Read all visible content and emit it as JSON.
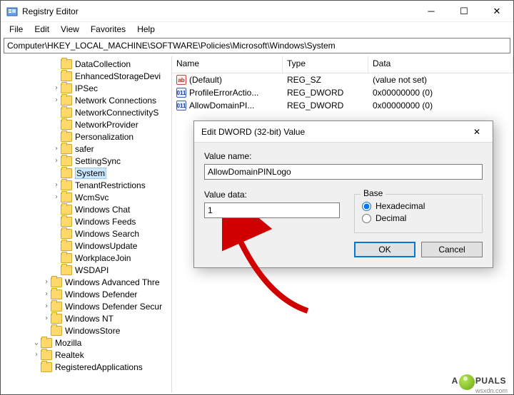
{
  "window": {
    "title": "Registry Editor"
  },
  "menu": {
    "file": "File",
    "edit": "Edit",
    "view": "View",
    "favorites": "Favorites",
    "help": "Help"
  },
  "address": {
    "path": "Computer\\HKEY_LOCAL_MACHINE\\SOFTWARE\\Policies\\Microsoft\\Windows\\System"
  },
  "tree": {
    "items": [
      {
        "depth": 5,
        "exp": "",
        "label": "DataCollection"
      },
      {
        "depth": 5,
        "exp": "",
        "label": "EnhancedStorageDevi"
      },
      {
        "depth": 5,
        "exp": ">",
        "label": "IPSec"
      },
      {
        "depth": 5,
        "exp": ">",
        "label": "Network Connections"
      },
      {
        "depth": 5,
        "exp": "",
        "label": "NetworkConnectivityS"
      },
      {
        "depth": 5,
        "exp": "",
        "label": "NetworkProvider"
      },
      {
        "depth": 5,
        "exp": "",
        "label": "Personalization"
      },
      {
        "depth": 5,
        "exp": ">",
        "label": "safer"
      },
      {
        "depth": 5,
        "exp": ">",
        "label": "SettingSync"
      },
      {
        "depth": 5,
        "exp": "",
        "label": "System",
        "selected": true
      },
      {
        "depth": 5,
        "exp": ">",
        "label": "TenantRestrictions"
      },
      {
        "depth": 5,
        "exp": ">",
        "label": "WcmSvc"
      },
      {
        "depth": 5,
        "exp": "",
        "label": "Windows Chat"
      },
      {
        "depth": 5,
        "exp": "",
        "label": "Windows Feeds"
      },
      {
        "depth": 5,
        "exp": "",
        "label": "Windows Search"
      },
      {
        "depth": 5,
        "exp": "",
        "label": "WindowsUpdate"
      },
      {
        "depth": 5,
        "exp": "",
        "label": "WorkplaceJoin"
      },
      {
        "depth": 5,
        "exp": "",
        "label": "WSDAPI"
      },
      {
        "depth": 4,
        "exp": ">",
        "label": "Windows Advanced Thre"
      },
      {
        "depth": 4,
        "exp": ">",
        "label": "Windows Defender"
      },
      {
        "depth": 4,
        "exp": ">",
        "label": "Windows Defender Secur"
      },
      {
        "depth": 4,
        "exp": ">",
        "label": "Windows NT"
      },
      {
        "depth": 4,
        "exp": "",
        "label": "WindowsStore"
      },
      {
        "depth": 3,
        "exp": "v",
        "label": "Mozilla"
      },
      {
        "depth": 3,
        "exp": ">",
        "label": "Realtek"
      },
      {
        "depth": 3,
        "exp": "",
        "label": "RegisteredApplications"
      }
    ]
  },
  "list": {
    "headers": {
      "name": "Name",
      "type": "Type",
      "data": "Data"
    },
    "rows": [
      {
        "ico": "sz",
        "name": "(Default)",
        "type": "REG_SZ",
        "data": "(value not set)"
      },
      {
        "ico": "dw",
        "name": "ProfileErrorActio...",
        "type": "REG_DWORD",
        "data": "0x00000000 (0)"
      },
      {
        "ico": "dw",
        "name": "AllowDomainPI...",
        "type": "REG_DWORD",
        "data": "0x00000000 (0)"
      }
    ]
  },
  "dialog": {
    "title": "Edit DWORD (32-bit) Value",
    "valueNameLabel": "Value name:",
    "valueName": "AllowDomainPINLogo",
    "valueDataLabel": "Value data:",
    "valueData": "1",
    "baseLabel": "Base",
    "hex": "Hexadecimal",
    "dec": "Decimal",
    "ok": "OK",
    "cancel": "Cancel"
  },
  "watermark": {
    "pre": "A",
    "post": "PUALS",
    "site": "wsxdn.com"
  }
}
